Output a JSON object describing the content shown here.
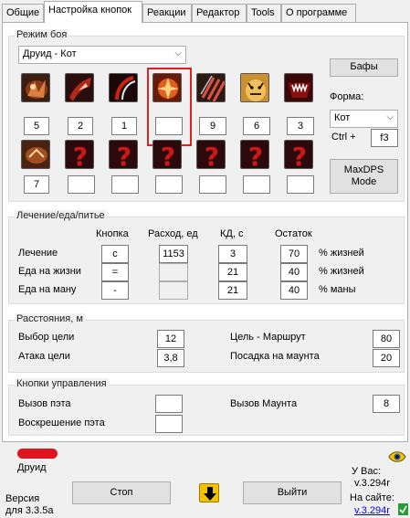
{
  "tabs": [
    "Общие",
    "Настройка кнопок",
    "Реакции",
    "Редактор",
    "Tools",
    "О программе"
  ],
  "combat": {
    "title": "Режим боя",
    "mode": "Друид - Кот",
    "row1_values": [
      "5",
      "2",
      "1",
      "",
      "9",
      "6",
      "3"
    ],
    "row2_values": [
      "7",
      "",
      "",
      "",
      "",
      "",
      ""
    ],
    "unknown_glyph": "?",
    "buffs_label": "Бафы",
    "form_label": "Форма:",
    "form_value": "Кот",
    "ctrl_label": "Ctrl +",
    "ctrl_value": "f3",
    "maxdps_label": "MaxDPS Mode"
  },
  "heal": {
    "title": "Лечение/еда/питье",
    "col_button": "Кнопка",
    "col_cost": "Расход, ед",
    "col_cd": "КД, с",
    "col_remain": "Остаток",
    "rows": [
      {
        "label": "Лечение",
        "button": "c",
        "cost": "1153",
        "cd": "3",
        "remain": "70",
        "unit": "% жизней"
      },
      {
        "label": "Еда на жизни",
        "button": "=",
        "cost": "",
        "cd": "21",
        "remain": "40",
        "unit": "% жизней"
      },
      {
        "label": "Еда на ману",
        "button": "-",
        "cost": "",
        "cd": "21",
        "remain": "40",
        "unit": "% маны"
      }
    ]
  },
  "distance": {
    "title": "Расстояния, м",
    "target_select_label": "Выбор цели",
    "target_select_value": "12",
    "attack_label": "Атака цели",
    "attack_value": "3,8",
    "route_label": "Цель - Маршрут",
    "route_value": "80",
    "mount_land_label": "Посадка на маунта",
    "mount_land_value": "20"
  },
  "controls": {
    "title": "Кнопки управления",
    "pet_call_label": "Вызов пэта",
    "pet_call_value": "",
    "pet_revive_label": "Воскрешение пэта",
    "pet_revive_value": "",
    "mount_call_label": "Вызов Маунта",
    "mount_call_value": "8"
  },
  "footer": {
    "class_label": "Друид",
    "version_label": "Версия",
    "version_for": "для 3.3.5a",
    "stop_label": "Стоп",
    "exit_label": "Выйти",
    "you_have_label": "У Вас:",
    "you_have_version": "v.3.294r",
    "site_label": "На сайте:",
    "site_version": "v.3.294r"
  },
  "colors": {
    "highlight": "#e02020",
    "link": "#0000ee",
    "arrow_button": "#f5c200"
  }
}
